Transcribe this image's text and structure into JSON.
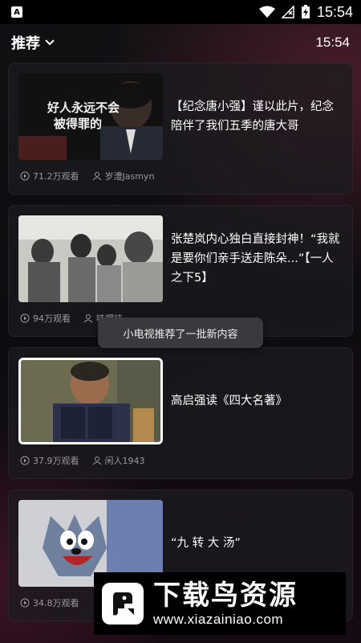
{
  "status_bar": {
    "app_icon_letter": "A",
    "time": "15:54"
  },
  "header": {
    "tab_label": "推荐",
    "time": "15:54"
  },
  "cards": [
    {
      "title": "【纪念唐小强】谨以此片，纪念陪伴了我们五季的唐大哥",
      "thumb_caption_1": "好人永远不会",
      "thumb_caption_2": "被得罪的",
      "views": "71.2万观看",
      "author": "岁澧Jasmyn"
    },
    {
      "title": "张楚岚内心独白直接封神！“我就是要你们亲手送走陈朵...”【一人之下5】",
      "views": "94万观看",
      "author": "哇哩哇..."
    },
    {
      "title": "高启强读《四大名著》",
      "views": "37.9万观看",
      "author": "闲人1943"
    },
    {
      "title": "“九 转 大 汤”",
      "views": "34.8万观看",
      "author": ""
    }
  ],
  "toast": "小电视推荐了一批新内容",
  "watermark": {
    "brand": "下载鸟资源",
    "url": "www.xiazainiao.com"
  },
  "colors": {
    "background": "#0b0b0d",
    "card": "#1c1c20",
    "meta_text": "#9a9aa0",
    "toast": "#3a3a3e"
  }
}
